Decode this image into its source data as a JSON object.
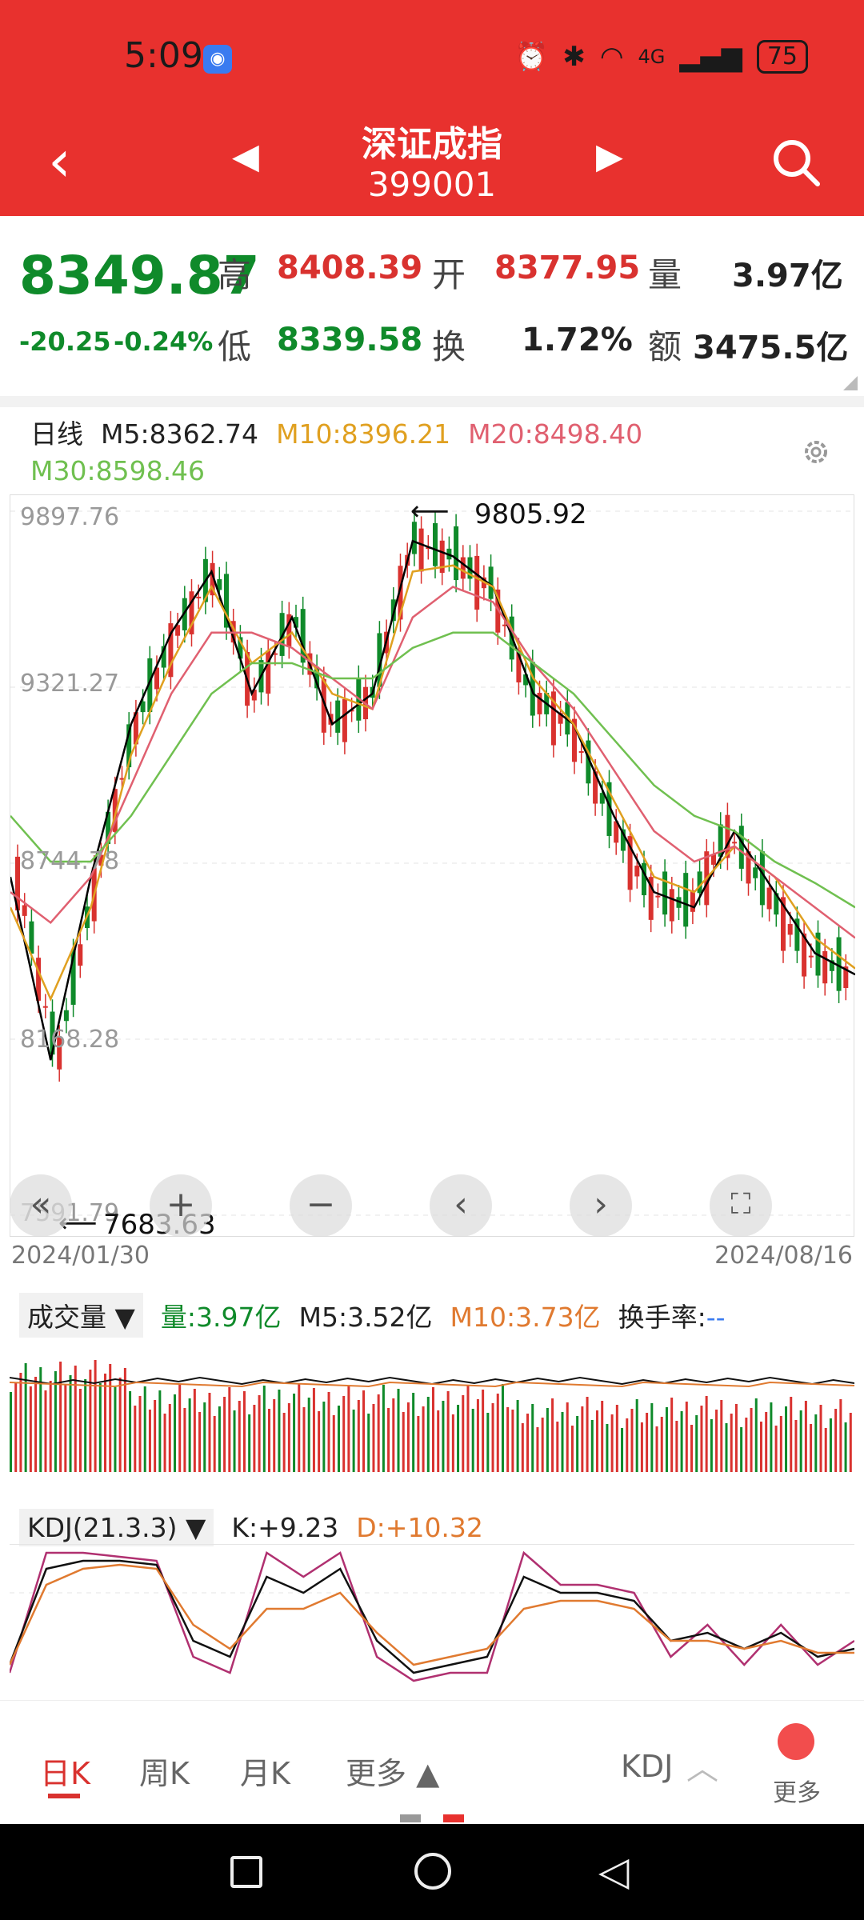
{
  "status": {
    "time": "5:09",
    "network": "4G",
    "battery": "75"
  },
  "header": {
    "title": "深证成指",
    "code": "399001"
  },
  "quote": {
    "price": "8349.87",
    "change": "-20.25",
    "change_pct": "-0.24%",
    "high_label": "高",
    "high": "8408.39",
    "open_label": "开",
    "open": "8377.95",
    "vol_label": "量",
    "vol": "3.97亿",
    "low_label": "低",
    "low": "8339.58",
    "turnover_label": "换",
    "turnover": "1.72%",
    "amount_label": "额",
    "amount": "3475.5亿"
  },
  "ma": {
    "period": "日线",
    "m5": "M5:8362.74",
    "m10": "M10:8396.21",
    "m20": "M20:8498.40",
    "m30": "M30:8598.46"
  },
  "chart": {
    "price_labels": [
      "9897.76",
      "9321.27",
      "8744.78",
      "8168.28",
      "7591.79"
    ],
    "max_note": "9805.92",
    "min_note": "7683.63",
    "start_date": "2024/01/30",
    "end_date": "2024/08/16"
  },
  "controls": {
    "first": "«",
    "zoom_in": "+",
    "zoom_out": "−",
    "prev": "‹",
    "next": "›",
    "fullscreen": "⛶"
  },
  "volume": {
    "selector": "成交量 ▼",
    "vol": "量:3.97亿",
    "m5": "M5:3.52亿",
    "m10": "M10:3.73亿",
    "turnover_label": "换手率:",
    "turnover_val": "--"
  },
  "kdj": {
    "selector": "KDJ(21.3.3) ▼",
    "k": "K:+9.23",
    "d": "D:+10.32"
  },
  "bottom": {
    "tabs": [
      "日K",
      "周K",
      "月K",
      "更多 ▲"
    ],
    "indicator": "KDJ",
    "more": "更多"
  },
  "colors": {
    "up": "#d9322f",
    "down": "#0f8a2a",
    "m5": "#000000",
    "m10": "#e0a020",
    "m20": "#e06070",
    "m30": "#70c050",
    "header": "#e8312e"
  },
  "chart_data": {
    "type": "line",
    "x_range": [
      "2024/01/30",
      "2024/08/16"
    ],
    "ylim": [
      7591.79,
      9897.76
    ],
    "ticks": [
      "9897.76",
      "9321.27",
      "8744.78",
      "8168.28",
      "7591.79"
    ],
    "series": [
      {
        "name": "M5",
        "values": [
          8700,
          8100,
          8700,
          9200,
          9500,
          9700,
          9300,
          9550,
          9200,
          9300,
          9800,
          9750,
          9650,
          9300,
          9200,
          8900,
          8650,
          8600,
          8850,
          8650,
          8450,
          8380
        ]
      },
      {
        "name": "M10",
        "values": [
          8600,
          8300,
          8600,
          9100,
          9400,
          9650,
          9400,
          9500,
          9300,
          9250,
          9700,
          9720,
          9650,
          9350,
          9200,
          8950,
          8700,
          8650,
          8800,
          8700,
          8500,
          8400
        ]
      },
      {
        "name": "M20",
        "values": [
          8650,
          8550,
          8700,
          9000,
          9300,
          9500,
          9500,
          9450,
          9350,
          9250,
          9550,
          9650,
          9600,
          9400,
          9250,
          9050,
          8850,
          8750,
          8800,
          8700,
          8600,
          8500
        ]
      },
      {
        "name": "M30",
        "values": [
          8900,
          8750,
          8750,
          8900,
          9100,
          9300,
          9400,
          9400,
          9350,
          9350,
          9450,
          9500,
          9500,
          9400,
          9300,
          9150,
          9000,
          8900,
          8850,
          8750,
          8680,
          8600
        ]
      }
    ]
  }
}
